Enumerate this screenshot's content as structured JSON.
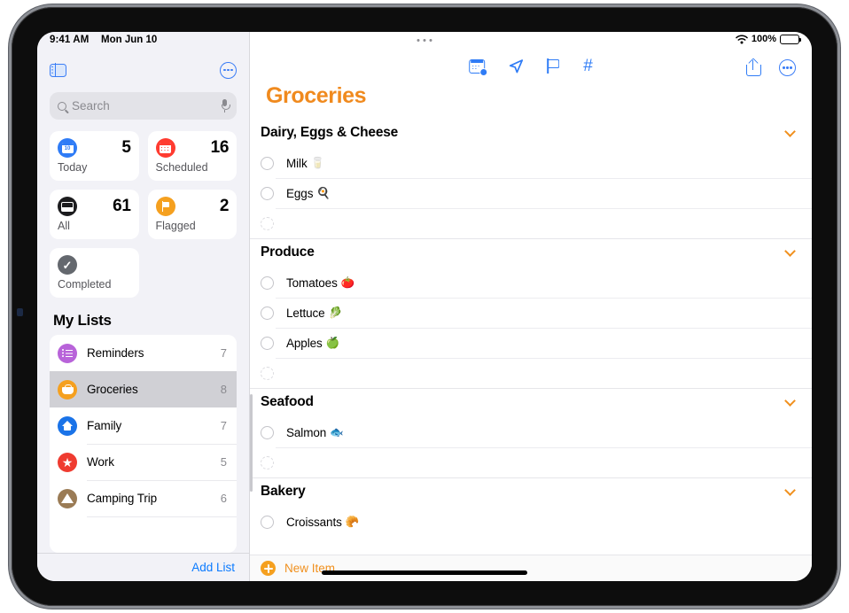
{
  "status_bar": {
    "time": "9:41 AM",
    "date": "Mon Jun 10",
    "battery_percent": "100%",
    "wifi_icon": "wifi-icon",
    "battery_icon": "battery-icon",
    "dots_icon": "multitasking-dots-icon"
  },
  "sidebar": {
    "toggle_icon": "sidebar-toggle-icon",
    "more_icon": "more-circle-icon",
    "search": {
      "placeholder": "Search",
      "search_icon": "search-icon",
      "mic_icon": "microphone-icon"
    },
    "smart_lists": [
      {
        "label": "Today",
        "count": "5",
        "icon": "calendar-today-icon",
        "color": "#2f7cf6"
      },
      {
        "label": "Scheduled",
        "count": "16",
        "icon": "calendar-icon",
        "color": "#ff3b30"
      },
      {
        "label": "All",
        "count": "61",
        "icon": "inbox-all-icon",
        "color": "#1c1c1e"
      },
      {
        "label": "Flagged",
        "count": "2",
        "icon": "flag-icon",
        "color": "#f5a01f"
      },
      {
        "label": "Completed",
        "count": "",
        "icon": "checkmark-icon",
        "color": "#64686e"
      }
    ],
    "my_lists_title": "My Lists",
    "lists": [
      {
        "name": "Reminders",
        "count": "7",
        "icon": "bulleted-list-icon",
        "color": "#b863d9",
        "selected": false
      },
      {
        "name": "Groceries",
        "count": "8",
        "icon": "basket-icon",
        "color": "#f5a01f",
        "selected": true
      },
      {
        "name": "Family",
        "count": "7",
        "icon": "house-icon",
        "color": "#1a73e8",
        "selected": false
      },
      {
        "name": "Work",
        "count": "5",
        "icon": "star-icon",
        "color": "#ef3b30",
        "selected": false
      },
      {
        "name": "Camping Trip",
        "count": "6",
        "icon": "tent-icon",
        "color": "#9a7b55",
        "selected": false
      }
    ],
    "add_list_label": "Add List"
  },
  "main": {
    "toolbar": {
      "center_icons": [
        {
          "name": "schedule-calendar-icon",
          "label": "Add Date"
        },
        {
          "name": "location-arrow-icon",
          "label": "Add Location"
        },
        {
          "name": "flag-icon",
          "label": "Flag"
        },
        {
          "name": "hashtag-icon",
          "label": "Add Tag"
        }
      ],
      "right_icons": [
        {
          "name": "share-icon",
          "label": "Share"
        },
        {
          "name": "more-circle-icon",
          "label": "More"
        }
      ]
    },
    "title": "Groceries",
    "sections": [
      {
        "title": "Dairy, Eggs & Cheese",
        "chevron_icon": "chevron-down-icon",
        "items": [
          {
            "text": "Milk",
            "emoji": "🥛"
          },
          {
            "text": "Eggs",
            "emoji": "🍳"
          }
        ],
        "has_new_row": true
      },
      {
        "title": "Produce",
        "chevron_icon": "chevron-down-icon",
        "items": [
          {
            "text": "Tomatoes",
            "emoji": "🍅"
          },
          {
            "text": "Lettuce",
            "emoji": "🥬"
          },
          {
            "text": "Apples",
            "emoji": "🍏"
          }
        ],
        "has_new_row": true
      },
      {
        "title": "Seafood",
        "chevron_icon": "chevron-down-icon",
        "items": [
          {
            "text": "Salmon",
            "emoji": "🐟"
          }
        ],
        "has_new_row": true
      },
      {
        "title": "Bakery",
        "chevron_icon": "chevron-down-icon",
        "items": [
          {
            "text": "Croissants",
            "emoji": "🥐"
          }
        ],
        "has_new_row": false
      }
    ],
    "new_item_label": "New Item",
    "new_item_icon": "plus-circle-icon"
  },
  "colors": {
    "accent_orange": "#f0901e",
    "accent_blue": "#0a7aff",
    "toolbar_blue": "#2f7cf6",
    "sidebar_bg": "#f2f2f7"
  }
}
